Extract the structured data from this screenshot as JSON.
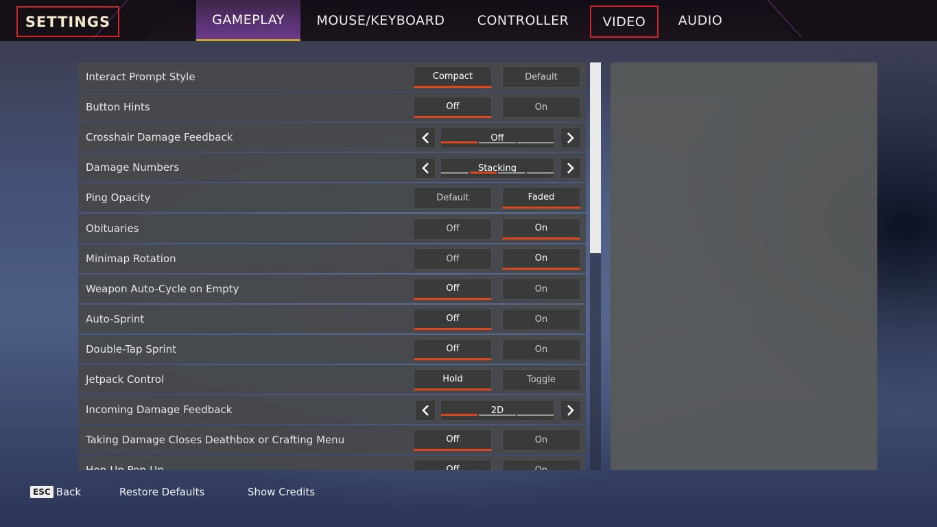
{
  "header": {
    "title": "SETTINGS",
    "tabs": [
      {
        "label": "GAMEPLAY",
        "active": true
      },
      {
        "label": "MOUSE/KEYBOARD",
        "active": false
      },
      {
        "label": "CONTROLLER",
        "active": false
      },
      {
        "label": "VIDEO",
        "active": false
      },
      {
        "label": "AUDIO",
        "active": false
      }
    ]
  },
  "settings": [
    {
      "label": "Interact Prompt Style",
      "type": "toggle",
      "options": [
        "Compact",
        "Default"
      ],
      "selected": 0
    },
    {
      "label": "Button Hints",
      "type": "toggle",
      "options": [
        "Off",
        "On"
      ],
      "selected": 0
    },
    {
      "label": "Crosshair Damage Feedback",
      "type": "cycle",
      "value": "Off",
      "segments": 3,
      "active_segment": 0
    },
    {
      "label": "Damage Numbers",
      "type": "cycle",
      "value": "Stacking",
      "segments": 4,
      "active_segment": 1
    },
    {
      "label": "Ping Opacity",
      "type": "toggle",
      "options": [
        "Default",
        "Faded"
      ],
      "selected": 1
    },
    {
      "label": "Obituaries",
      "type": "toggle",
      "options": [
        "Off",
        "On"
      ],
      "selected": 1
    },
    {
      "label": "Minimap Rotation",
      "type": "toggle",
      "options": [
        "Off",
        "On"
      ],
      "selected": 1
    },
    {
      "label": "Weapon Auto-Cycle on Empty",
      "type": "toggle",
      "options": [
        "Off",
        "On"
      ],
      "selected": 0
    },
    {
      "label": "Auto-Sprint",
      "type": "toggle",
      "options": [
        "Off",
        "On"
      ],
      "selected": 0
    },
    {
      "label": "Double-Tap Sprint",
      "type": "toggle",
      "options": [
        "Off",
        "On"
      ],
      "selected": 0
    },
    {
      "label": "Jetpack Control",
      "type": "toggle",
      "options": [
        "Hold",
        "Toggle"
      ],
      "selected": 0
    },
    {
      "label": "Incoming Damage Feedback",
      "type": "cycle",
      "value": "2D",
      "segments": 3,
      "active_segment": 0
    },
    {
      "label": "Taking Damage Closes Deathbox or Crafting Menu",
      "type": "toggle",
      "options": [
        "Off",
        "On"
      ],
      "selected": 0
    },
    {
      "label": "Hop-Up Pop-Up",
      "type": "toggle",
      "options": [
        "Off",
        "On"
      ],
      "selected": 0
    }
  ],
  "footer": {
    "esc_key": "ESC",
    "back_label": "Back",
    "restore_label": "Restore Defaults",
    "credits_label": "Show Credits"
  },
  "colors": {
    "accent_orange": "#e0461c",
    "active_tab_underline": "#caa232",
    "highlight_box": "#d2222a"
  }
}
